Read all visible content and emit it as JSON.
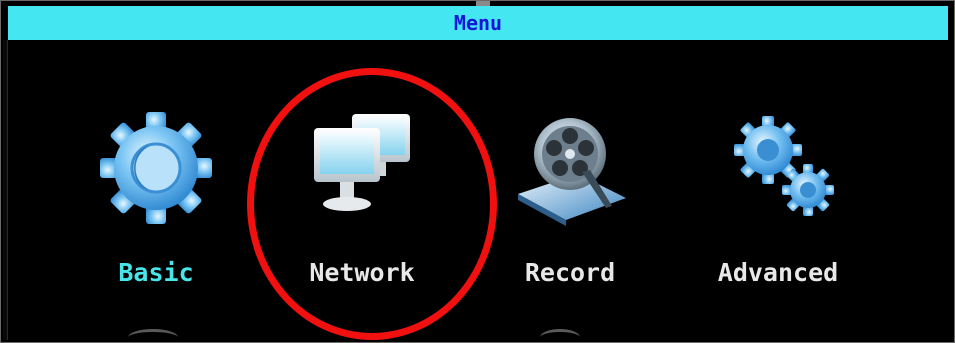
{
  "window": {
    "title": "Menu"
  },
  "menu": {
    "items": [
      {
        "label": "Basic",
        "icon": "gear-icon",
        "selected": true
      },
      {
        "label": "Network",
        "icon": "network-computers-icon",
        "selected": false
      },
      {
        "label": "Record",
        "icon": "film-reel-record-icon",
        "selected": false
      },
      {
        "label": "Advanced",
        "icon": "double-gear-icon",
        "selected": false
      }
    ]
  },
  "colors": {
    "title_bar": "#44e6f2",
    "title_text": "#1616d8",
    "background": "#000000",
    "selected_label": "#48e6ea",
    "label": "#e8e8e8",
    "annotation_circle": "#f01010"
  }
}
